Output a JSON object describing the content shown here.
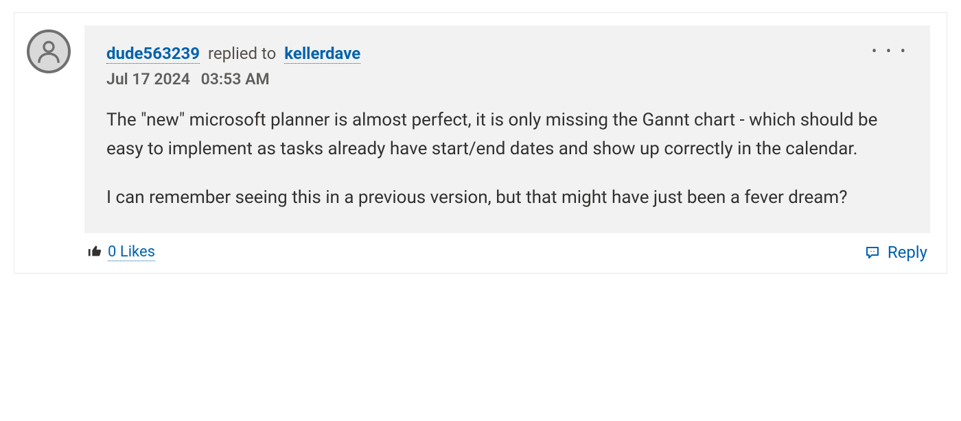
{
  "comment": {
    "author": "dude563239",
    "replied_to_text": "replied to",
    "target_user": "kellerdave",
    "date": "Jul 17 2024",
    "time": "03:53 AM",
    "body": {
      "p1": "The \"new\" microsoft planner is almost perfect, it is only missing the Gannt chart - which should be easy to implement as tasks already have start/end dates and show up correctly in the calendar.",
      "p2": "I can remember seeing this in a previous version, but that might have just been a fever dream?"
    },
    "likes_count": "0",
    "likes_label": "Likes",
    "reply_label": "Reply"
  }
}
